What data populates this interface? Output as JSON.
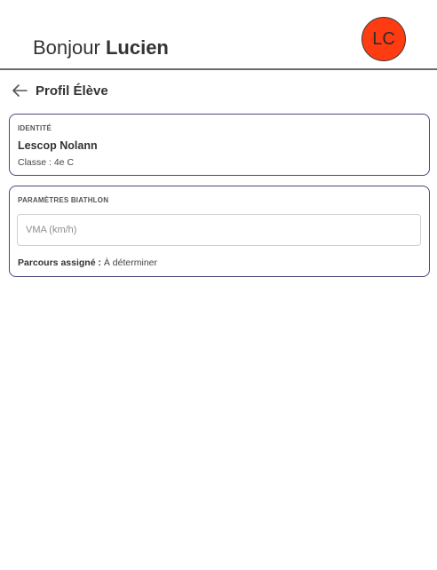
{
  "header": {
    "greeting_prefix": "Bonjour",
    "user_name": "Lucien",
    "avatar_initials": "LC",
    "avatar_color": "#ff3b12"
  },
  "subheader": {
    "back_icon": "arrow-left-icon",
    "title": "Profil Élève"
  },
  "identity": {
    "section_label": "IDENTITÉ",
    "student_name": "Lescop Nolann",
    "class_text": "Classe : 4e C"
  },
  "biathlon": {
    "section_label": "PARAMÈTRES BIATHLON",
    "vma_value": "",
    "vma_placeholder": "VMA (km/h)",
    "parcours_label": "Parcours assigné :",
    "parcours_value": "À déterminer"
  },
  "colors": {
    "card_border": "#4a4a7a",
    "text_primary": "#333333"
  }
}
